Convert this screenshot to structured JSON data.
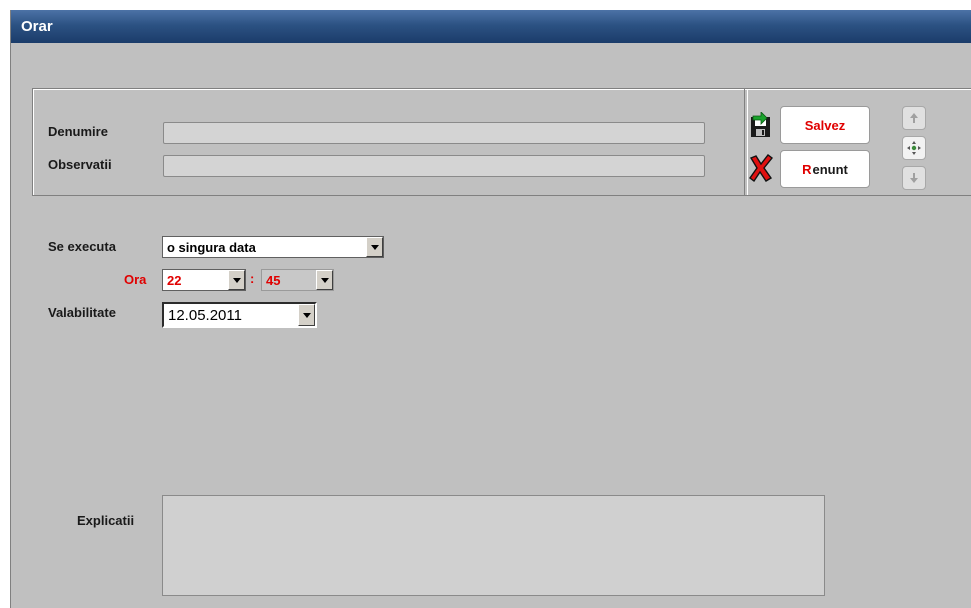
{
  "window": {
    "title": "Orar"
  },
  "form": {
    "denumire_label": "Denumire",
    "denumire_value": "",
    "observatii_label": "Observatii",
    "observatii_value": ""
  },
  "actions": {
    "save_label": "Salvez",
    "cancel_first": "R",
    "cancel_rest": "enunt",
    "save_icon": "floppy-save-icon",
    "cancel_icon": "red-x-icon",
    "nav_up_icon": "arrow-up-icon",
    "nav_move_icon": "move-icon",
    "nav_down_icon": "arrow-down-icon"
  },
  "schedule": {
    "se_executa_label": "Se executa",
    "se_executa_value": "o singura data",
    "ora_label": "Ora",
    "hour_value": "22",
    "time_separator": ":",
    "minute_value": "45",
    "valabilitate_label": "Valabilitate",
    "valabilitate_value": "12.05.2011"
  },
  "explicatii": {
    "label": "Explicatii",
    "value": ""
  },
  "colors": {
    "title_bar": "#2c5283",
    "accent_red": "#e00000",
    "window_bg": "#c0c0c0"
  }
}
